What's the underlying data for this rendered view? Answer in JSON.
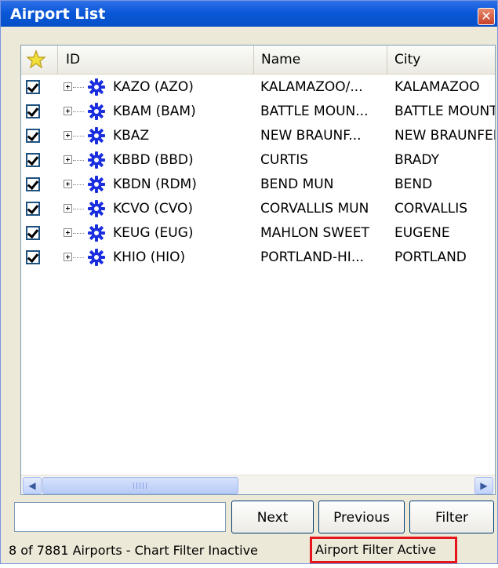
{
  "window": {
    "title": "Airport List",
    "close_label": "✕"
  },
  "columns": {
    "id": "ID",
    "name": "Name",
    "city": "City"
  },
  "rows": [
    {
      "checked": true,
      "id": "KAZO (AZO)",
      "name": "KALAMAZOO/...",
      "city": "KALAMAZOO"
    },
    {
      "checked": true,
      "id": "KBAM (BAM)",
      "name": "BATTLE MOUN...",
      "city": "BATTLE MOUNT."
    },
    {
      "checked": true,
      "id": "KBAZ",
      "name": "NEW BRAUNF...",
      "city": "NEW BRAUNFEL"
    },
    {
      "checked": true,
      "id": "KBBD (BBD)",
      "name": "CURTIS",
      "city": "BRADY"
    },
    {
      "checked": true,
      "id": "KBDN (RDM)",
      "name": "BEND MUN",
      "city": "BEND"
    },
    {
      "checked": true,
      "id": "KCVO (CVO)",
      "name": "CORVALLIS MUN",
      "city": "CORVALLIS"
    },
    {
      "checked": true,
      "id": "KEUG (EUG)",
      "name": "MAHLON SWEET",
      "city": "EUGENE"
    },
    {
      "checked": true,
      "id": "KHIO (HIO)",
      "name": "PORTLAND-HI...",
      "city": "PORTLAND"
    }
  ],
  "search": {
    "value": "",
    "placeholder": ""
  },
  "buttons": {
    "next": "Next",
    "previous": "Previous",
    "filter": "Filter"
  },
  "status": {
    "left": "8 of 7881 Airports - Chart Filter Inactive",
    "right": "Airport Filter Active"
  },
  "icons": {
    "star": "star-icon",
    "airport": "airport-icon",
    "close": "close-icon"
  },
  "colors": {
    "titlebar": "#0a58d8",
    "airport_icon": "#1a2ee0",
    "highlight_border": "#e5151b"
  }
}
